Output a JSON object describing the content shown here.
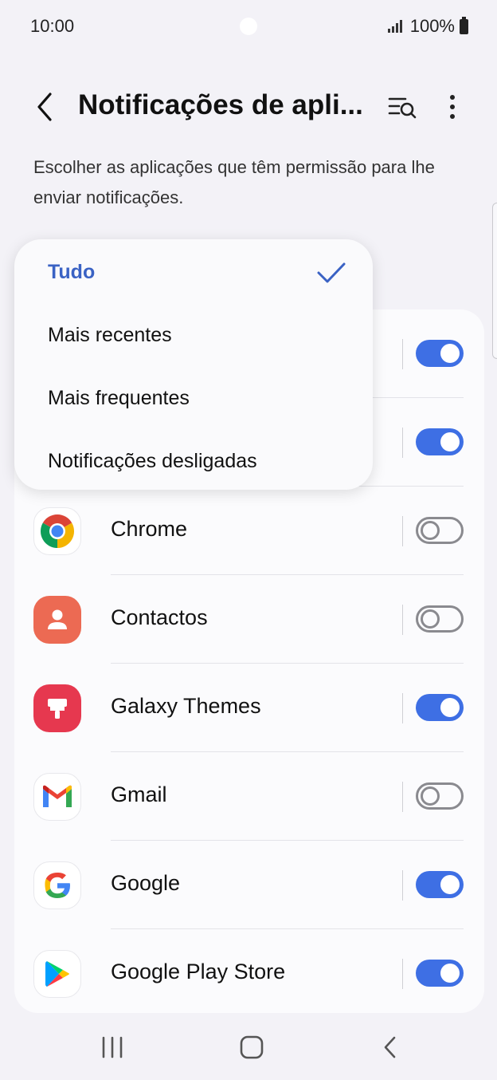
{
  "status_bar": {
    "time": "10:00",
    "battery_text": "100%",
    "icons": [
      "signal-icon",
      "battery-icon"
    ]
  },
  "header": {
    "title": "Notificações de apli...",
    "back_icon": "back-chevron-icon",
    "search_icon": "list-search-icon",
    "more_icon": "more-vertical-icon"
  },
  "description": "Escolher as aplicações que têm permissão para lhe enviar notificações.",
  "filter_menu": {
    "selected": "Tudo",
    "items": [
      {
        "label": "Tudo",
        "selected": true
      },
      {
        "label": "Mais recentes",
        "selected": false
      },
      {
        "label": "Mais frequentes",
        "selected": false
      },
      {
        "label": "Notificações desligadas",
        "selected": false
      }
    ]
  },
  "apps": [
    {
      "name": "Chrome",
      "icon": "chrome-icon",
      "enabled": false
    },
    {
      "name": "Contactos",
      "icon": "contacts-icon",
      "enabled": false
    },
    {
      "name": "Galaxy Themes",
      "icon": "galaxy-themes-icon",
      "enabled": true
    },
    {
      "name": "Gmail",
      "icon": "gmail-icon",
      "enabled": false
    },
    {
      "name": "Google",
      "icon": "google-icon",
      "enabled": true
    },
    {
      "name": "Google Play Store",
      "icon": "play-store-icon",
      "enabled": true
    }
  ],
  "hidden_rows": [
    {
      "enabled": true
    },
    {
      "enabled": true
    }
  ],
  "colors": {
    "accent": "#3e6fe4",
    "selected_text": "#3a62c4",
    "toggle_off": "#8a8a8f"
  },
  "nav_bar": {
    "icons": [
      "recent-apps-icon",
      "home-icon",
      "back-icon"
    ]
  }
}
